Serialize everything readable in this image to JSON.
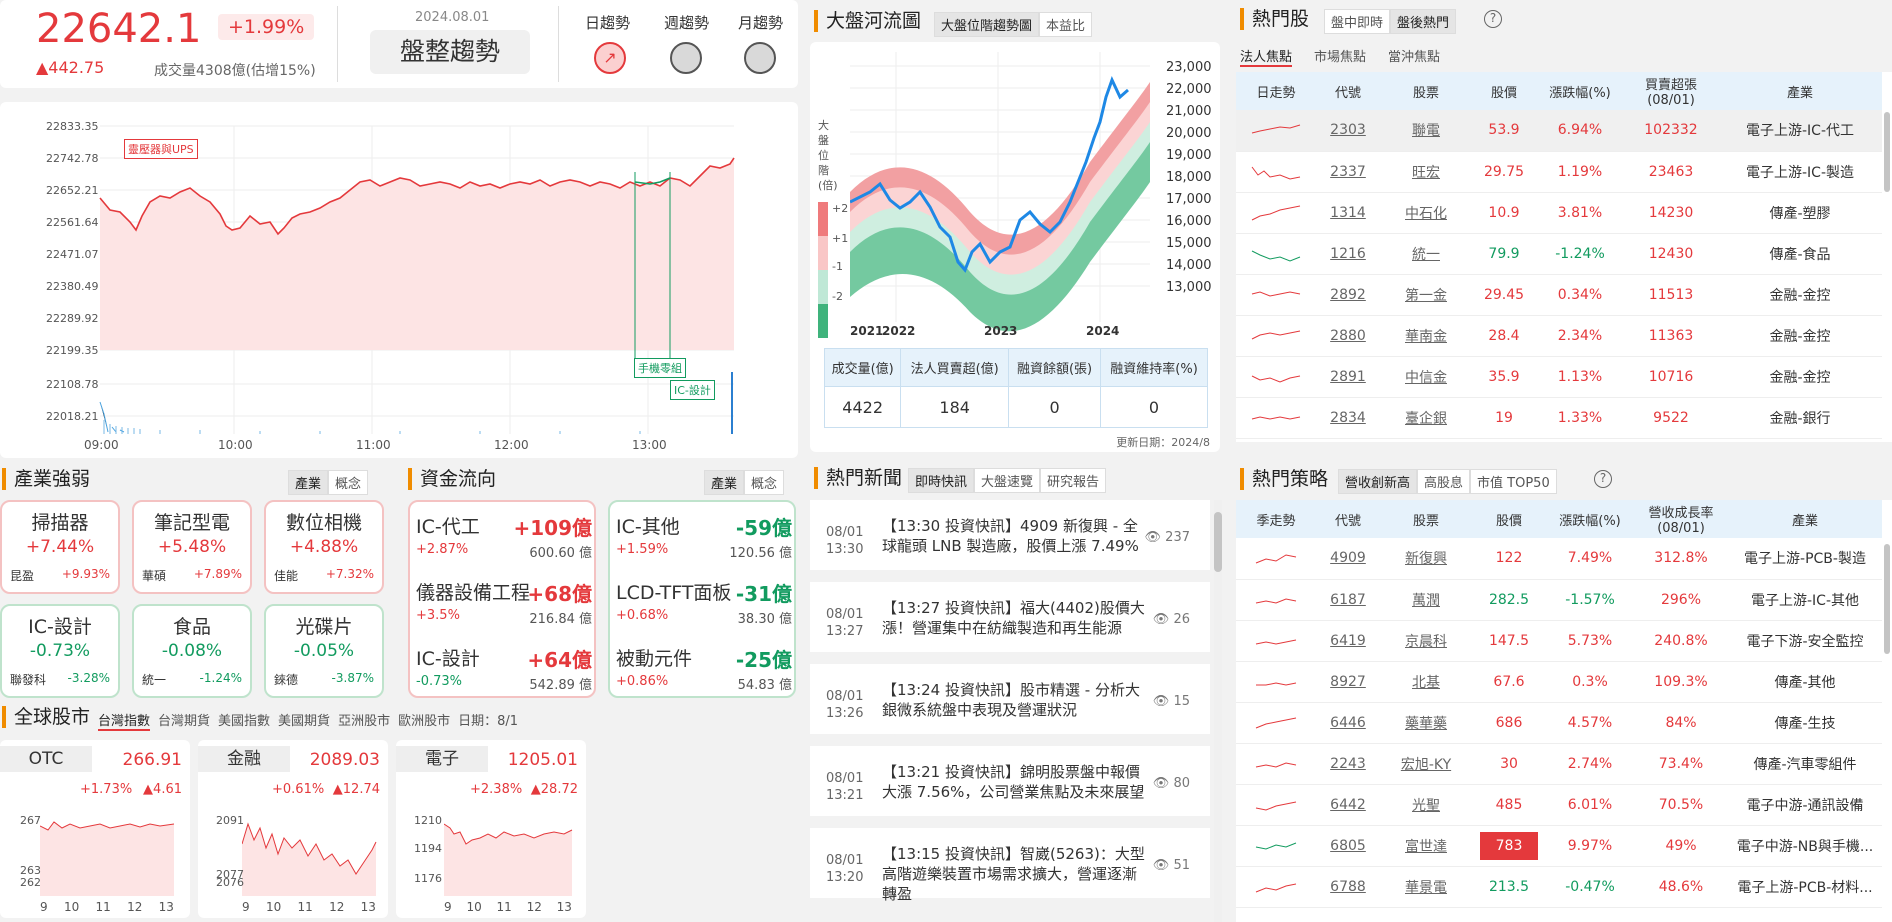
{
  "index": {
    "value": "22642.1",
    "pct": "+1.99%",
    "change": "▲442.75",
    "volume": "成交量4308億(估增15%)",
    "date": "2024.08.01",
    "trend": "盤整趨勢",
    "trend_tabs": [
      "日趨勢",
      "週趨勢",
      "月趨勢"
    ]
  },
  "intraday": {
    "ylabels": [
      "22833.35",
      "22742.78",
      "22652.21",
      "22561.64",
      "22471.07",
      "22380.49",
      "22289.92",
      "22199.35"
    ],
    "vlabels": [
      "22108.78",
      "22018.21"
    ],
    "xlabels": [
      "09:00",
      "10:00",
      "11:00",
      "12:00",
      "13:00"
    ],
    "annotations": [
      "靈壓器與UPS",
      "手機零組",
      "IC-設計"
    ]
  },
  "river": {
    "title": "大盤河流圖",
    "tabs": [
      "大盤位階趨勢圖",
      "本益比"
    ],
    "ylabels": [
      "23,000",
      "22,000",
      "21,000",
      "20,000",
      "19,000",
      "18,000",
      "17,000",
      "16,000",
      "15,000",
      "14,000",
      "13,000"
    ],
    "xlabels": [
      "2021",
      "2022",
      "2023",
      "2024"
    ],
    "left_label": "大盤位階(倍)",
    "band_labels": [
      "+2",
      "+1",
      "-1",
      "-2"
    ],
    "stats_headers": [
      "成交量(億)",
      "法人買賣超(億)",
      "融資餘額(張)",
      "融資維持率(%)"
    ],
    "stats_values": [
      "4422",
      "184",
      "0",
      "0"
    ],
    "updated": "更新日期：2024/8"
  },
  "hot": {
    "title": "熱門股",
    "tabs": [
      "盤中即時",
      "盤後熱門"
    ],
    "subtabs": [
      "法人焦點",
      "市場焦點",
      "當沖焦點"
    ],
    "headers": [
      "日走勢",
      "代號",
      "股票",
      "股價",
      "漲跌幅(%)",
      "買賣超張(08/01)",
      "產業"
    ],
    "rows": [
      [
        "2303",
        "聯電",
        "53.9",
        "6.94%",
        "102332",
        "電子上游-IC-代工"
      ],
      [
        "2337",
        "旺宏",
        "29.75",
        "1.19%",
        "23463",
        "電子上游-IC-製造"
      ],
      [
        "1314",
        "中石化",
        "10.9",
        "3.81%",
        "14230",
        "傳產-塑膠"
      ],
      [
        "1216",
        "統一",
        "79.9",
        "-1.24%",
        "12430",
        "傳產-食品"
      ],
      [
        "2892",
        "第一金",
        "29.45",
        "0.34%",
        "11513",
        "金融-金控"
      ],
      [
        "2880",
        "華南金",
        "28.4",
        "2.34%",
        "11363",
        "金融-金控"
      ],
      [
        "2891",
        "中信金",
        "35.9",
        "1.13%",
        "10716",
        "金融-金控"
      ],
      [
        "2834",
        "臺企銀",
        "19",
        "1.33%",
        "9522",
        "金融-銀行"
      ]
    ]
  },
  "sector": {
    "title": "產業強弱",
    "tabs": [
      "產業",
      "概念"
    ],
    "cards": [
      [
        "掃描器",
        "+7.44%",
        "昆盈",
        "+9.93%"
      ],
      [
        "筆記型電",
        "+5.48%",
        "華碩",
        "+7.89%"
      ],
      [
        "數位相機",
        "+4.88%",
        "佳能",
        "+7.32%"
      ],
      [
        "IC-設計",
        "-0.73%",
        "聯發科",
        "-3.28%"
      ],
      [
        "食品",
        "-0.08%",
        "統一",
        "-1.24%"
      ],
      [
        "光碟片",
        "-0.05%",
        "錸德",
        "-3.87%"
      ]
    ]
  },
  "flow": {
    "title": "資金流向",
    "tabs": [
      "產業",
      "概念"
    ],
    "pos": [
      [
        "IC-代工",
        "+109億",
        "+2.87%",
        "600.60 億"
      ],
      [
        "儀器設備工程",
        "+68億",
        "+3.5%",
        "216.84 億"
      ],
      [
        "IC-設計",
        "+64億",
        "-0.73%",
        "542.89 億"
      ]
    ],
    "neg": [
      [
        "IC-其他",
        "-59億",
        "+1.59%",
        "120.56 億"
      ],
      [
        "LCD-TFT面板",
        "-31億",
        "+0.68%",
        "38.30 億"
      ],
      [
        "被動元件",
        "-25億",
        "+0.86%",
        "54.83 億"
      ]
    ]
  },
  "global": {
    "title": "全球股市",
    "tabs": [
      "台灣指數",
      "台灣期貨",
      "美國指數",
      "美國期貨",
      "亞洲股市",
      "歐洲股市"
    ],
    "date": "日期：8/1",
    "cards": [
      {
        "name": "OTC",
        "value": "266.91",
        "pct": "+1.73%",
        "chg": "▲4.61",
        "y": [
          "267",
          "263",
          "262"
        ]
      },
      {
        "name": "金融",
        "value": "2089.03",
        "pct": "+0.61%",
        "chg": "▲12.74",
        "y": [
          "2091",
          "2077",
          "2076"
        ]
      },
      {
        "name": "電子",
        "value": "1205.01",
        "pct": "+2.38%",
        "chg": "▲28.72",
        "y": [
          "1210",
          "1194",
          "1176"
        ]
      }
    ],
    "x": [
      "9",
      "10",
      "11",
      "12",
      "13"
    ]
  },
  "news": {
    "title": "熱門新聞",
    "tabs": [
      "即時快訊",
      "大盤速覽",
      "研究報告"
    ],
    "items": [
      [
        "08/01",
        "13:30",
        "【13:30 投資快訊】4909 新復興 - 全球龍頭 LNB 製造廠，股價上漲 7.49%",
        "237"
      ],
      [
        "08/01",
        "13:27",
        "【13:27 投資快訊】福大(4402)股價大漲！營運集中在紡織製造和再生能源",
        "26"
      ],
      [
        "08/01",
        "13:26",
        "【13:24 投資快訊】股市精選 - 分析大銀微系統盤中表現及營運狀況",
        "15"
      ],
      [
        "08/01",
        "13:21",
        "【13:21 投資快訊】錦明股票盤中報價大漲 7.56%，公司營業焦點及未來展望",
        "80"
      ],
      [
        "08/01",
        "13:20",
        "【13:15 投資快訊】智崴(5263)：大型高階遊樂裝置市場需求擴大，營運逐漸轉盈",
        "51"
      ]
    ]
  },
  "strat": {
    "title": "熱門策略",
    "tabs": [
      "營收創新高",
      "高股息",
      "市值 TOP50"
    ],
    "headers": [
      "季走勢",
      "代號",
      "股票",
      "股價",
      "漲跌幅(%)",
      "營收成長率(08/01)",
      "產業"
    ],
    "rows": [
      [
        "4909",
        "新復興",
        "122",
        "7.49%",
        "312.8%",
        "電子上游-PCB-製造"
      ],
      [
        "6187",
        "萬潤",
        "282.5",
        "-1.57%",
        "296%",
        "電子上游-IC-其他"
      ],
      [
        "6419",
        "京晨科",
        "147.5",
        "5.73%",
        "240.8%",
        "電子下游-安全監控"
      ],
      [
        "8927",
        "北基",
        "67.6",
        "0.3%",
        "109.3%",
        "傳產-其他"
      ],
      [
        "6446",
        "藥華藥",
        "686",
        "4.57%",
        "84%",
        "傳產-生技"
      ],
      [
        "2243",
        "宏旭-KY",
        "30",
        "2.74%",
        "73.4%",
        "傳產-汽車零組件"
      ],
      [
        "6442",
        "光聖",
        "485",
        "6.01%",
        "70.5%",
        "電子中游-通訊設備"
      ],
      [
        "6805",
        "富世達",
        "783",
        "9.97%",
        "49%",
        "電子中游-NB與手機..."
      ],
      [
        "6788",
        "華景電",
        "213.5",
        "-0.47%",
        "48.6%",
        "電子上游-PCB-材料..."
      ]
    ]
  },
  "colors": {
    "up": "#e4393c",
    "down": "#129b5f",
    "accent": "#f08c00"
  }
}
